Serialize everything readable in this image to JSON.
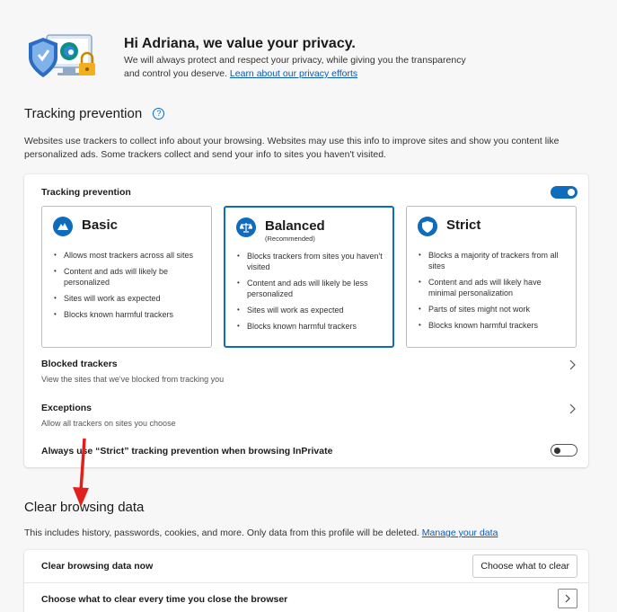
{
  "hero": {
    "title": "Hi Adriana, we value your privacy.",
    "desc": "We will always protect and respect your privacy, while giving you the transparency and control you deserve.",
    "link": "Learn about our privacy efforts"
  },
  "tracking": {
    "title": "Tracking prevention",
    "help_icon": "?",
    "desc": "Websites use trackers to collect info about your browsing. Websites may use this info to improve sites and show you content like personalized ads. Some trackers collect and send your info to sites you haven't visited.",
    "card_title": "Tracking prevention",
    "toggle_on": true,
    "options": [
      {
        "title": "Basic",
        "subtitle": "",
        "icon": "basic-icon",
        "bullets": [
          "Allows most trackers across all sites",
          "Content and ads will likely be personalized",
          "Sites will work as expected",
          "Blocks known harmful trackers"
        ]
      },
      {
        "title": "Balanced",
        "subtitle": "(Recommended)",
        "icon": "balanced-icon",
        "bullets": [
          "Blocks trackers from sites you haven't visited",
          "Content and ads will likely be less personalized",
          "Sites will work as expected",
          "Blocks known harmful trackers"
        ]
      },
      {
        "title": "Strict",
        "subtitle": "",
        "icon": "strict-icon",
        "bullets": [
          "Blocks a majority of trackers from all sites",
          "Content and ads will likely have minimal personalization",
          "Parts of sites might not work",
          "Blocks known harmful trackers"
        ]
      }
    ],
    "blocked": {
      "title": "Blocked trackers",
      "sub": "View the sites that we've blocked from tracking you"
    },
    "exceptions": {
      "title": "Exceptions",
      "sub": "Allow all trackers on sites you choose"
    },
    "inprivate": {
      "label": "Always use “Strict” tracking prevention when browsing InPrivate",
      "toggle_on": false
    }
  },
  "clear": {
    "title": "Clear browsing data",
    "desc": "This includes history, passwords, cookies, and more. Only data from this profile will be deleted.",
    "link": "Manage your data",
    "row1_label": "Clear browsing data now",
    "row1_button": "Choose what to clear",
    "row2_label": "Choose what to clear every time you close the browser"
  },
  "colors": {
    "accent": "#0f6cbd",
    "arrow": "#e0201b"
  }
}
